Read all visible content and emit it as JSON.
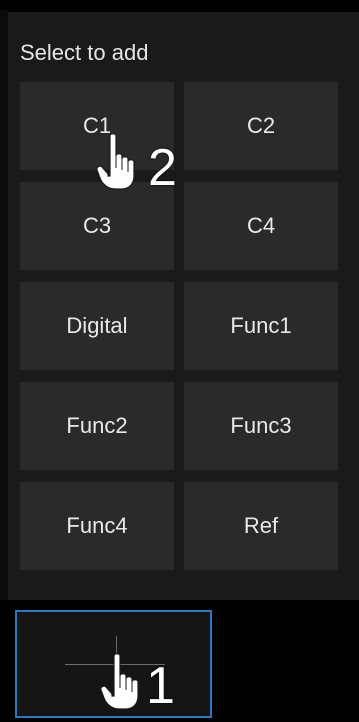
{
  "header": {
    "title": "Select to add"
  },
  "sources": [
    {
      "id": "c1",
      "label": "C1"
    },
    {
      "id": "c2",
      "label": "C2"
    },
    {
      "id": "c3",
      "label": "C3"
    },
    {
      "id": "c4",
      "label": "C4"
    },
    {
      "id": "digital",
      "label": "Digital"
    },
    {
      "id": "func1",
      "label": "Func1"
    },
    {
      "id": "func2",
      "label": "Func2"
    },
    {
      "id": "func3",
      "label": "Func3"
    },
    {
      "id": "func4",
      "label": "Func4"
    },
    {
      "id": "ref",
      "label": "Ref"
    }
  ],
  "annotations": {
    "step1": "1",
    "step2": "2",
    "icon": "pointing-hand-icon"
  },
  "colors": {
    "panel_bg": "#1a1a1a",
    "button_bg": "#2a2a2a",
    "selection_border": "#2c78c4"
  }
}
